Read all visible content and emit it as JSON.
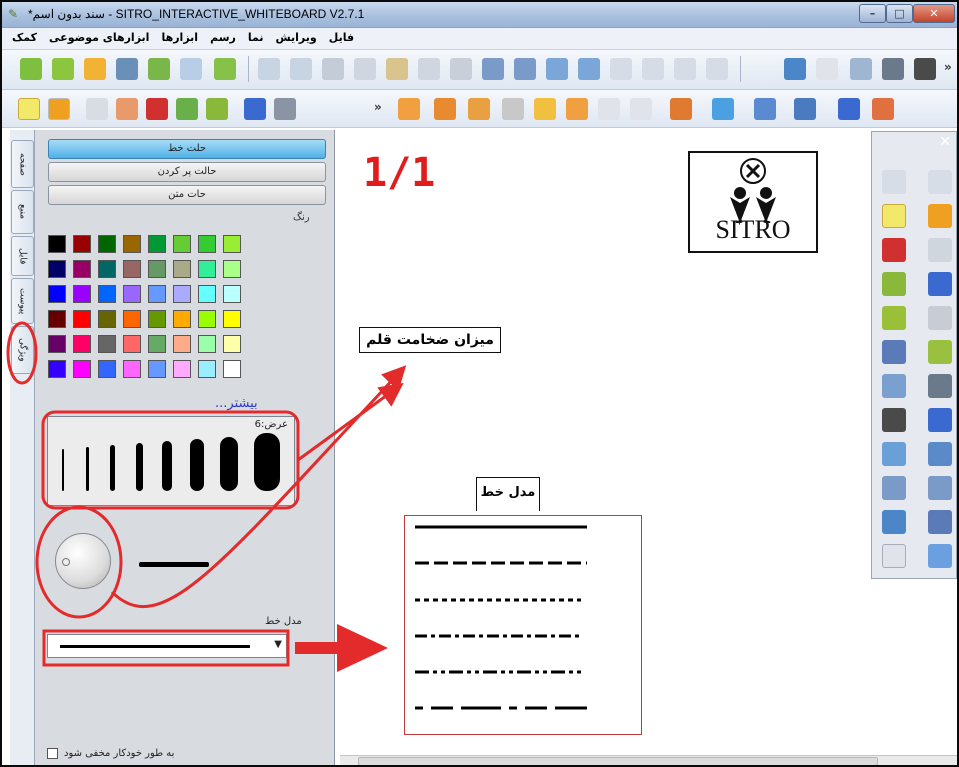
{
  "window": {
    "title": "*سند بدون اسم - SITRO_INTERACTIVE_WHITEBOARD V2.7.1",
    "icon": "whiteboard-app-icon",
    "controls": [
      "minimize",
      "maximize",
      "close"
    ]
  },
  "menu": [
    "فایل",
    "ویرایش",
    "نما",
    "رسم",
    "ابزارها",
    "ابزارهای موضوعی",
    "کمک"
  ],
  "side_tabs": [
    "صفحه",
    "منبع",
    "فایل",
    "پیوست",
    "ویژگی"
  ],
  "panel": {
    "modes": [
      "حلت خط",
      "حالت پر کردن",
      "حات متن"
    ],
    "color_title": "رنگ",
    "more_link": "...بیشتر",
    "width_label": "عرض:6",
    "line_style_label": "مدل خط",
    "autohide_label": "به طور خودکار مخفی شود"
  },
  "palette": [
    "#000000",
    "#990000",
    "#006600",
    "#996600",
    "#009933",
    "#66cc33",
    "#33cc33",
    "#99ee33",
    "#000066",
    "#990066",
    "#006666",
    "#996666",
    "#669966",
    "#aaaa88",
    "#33ee99",
    "#aaff88",
    "#0000ff",
    "#9900ff",
    "#0066ff",
    "#9966ff",
    "#6699ff",
    "#aaaaff",
    "#66ffff",
    "#bbffff",
    "#660000",
    "#ff0000",
    "#666600",
    "#ff6600",
    "#669900",
    "#ffaa00",
    "#99ff00",
    "#ffff00",
    "#660066",
    "#ff0066",
    "#666666",
    "#ff6666",
    "#66aa66",
    "#ffaa88",
    "#99ffaa",
    "#ffffaa",
    "#3300ff",
    "#ff00ff",
    "#3366ff",
    "#ff66ff",
    "#6699ff",
    "#ffaaff",
    "#99eeff",
    "#ffffff"
  ],
  "canvas": {
    "page_counter": "1/1",
    "logo_text": "SITRO",
    "pen_thickness_callout": "میزان ضخامت قلم",
    "line_model_callout": "مدل خط"
  },
  "accent": {
    "highlight": "#e32b2b",
    "active_mode": "#4fb0e6"
  }
}
